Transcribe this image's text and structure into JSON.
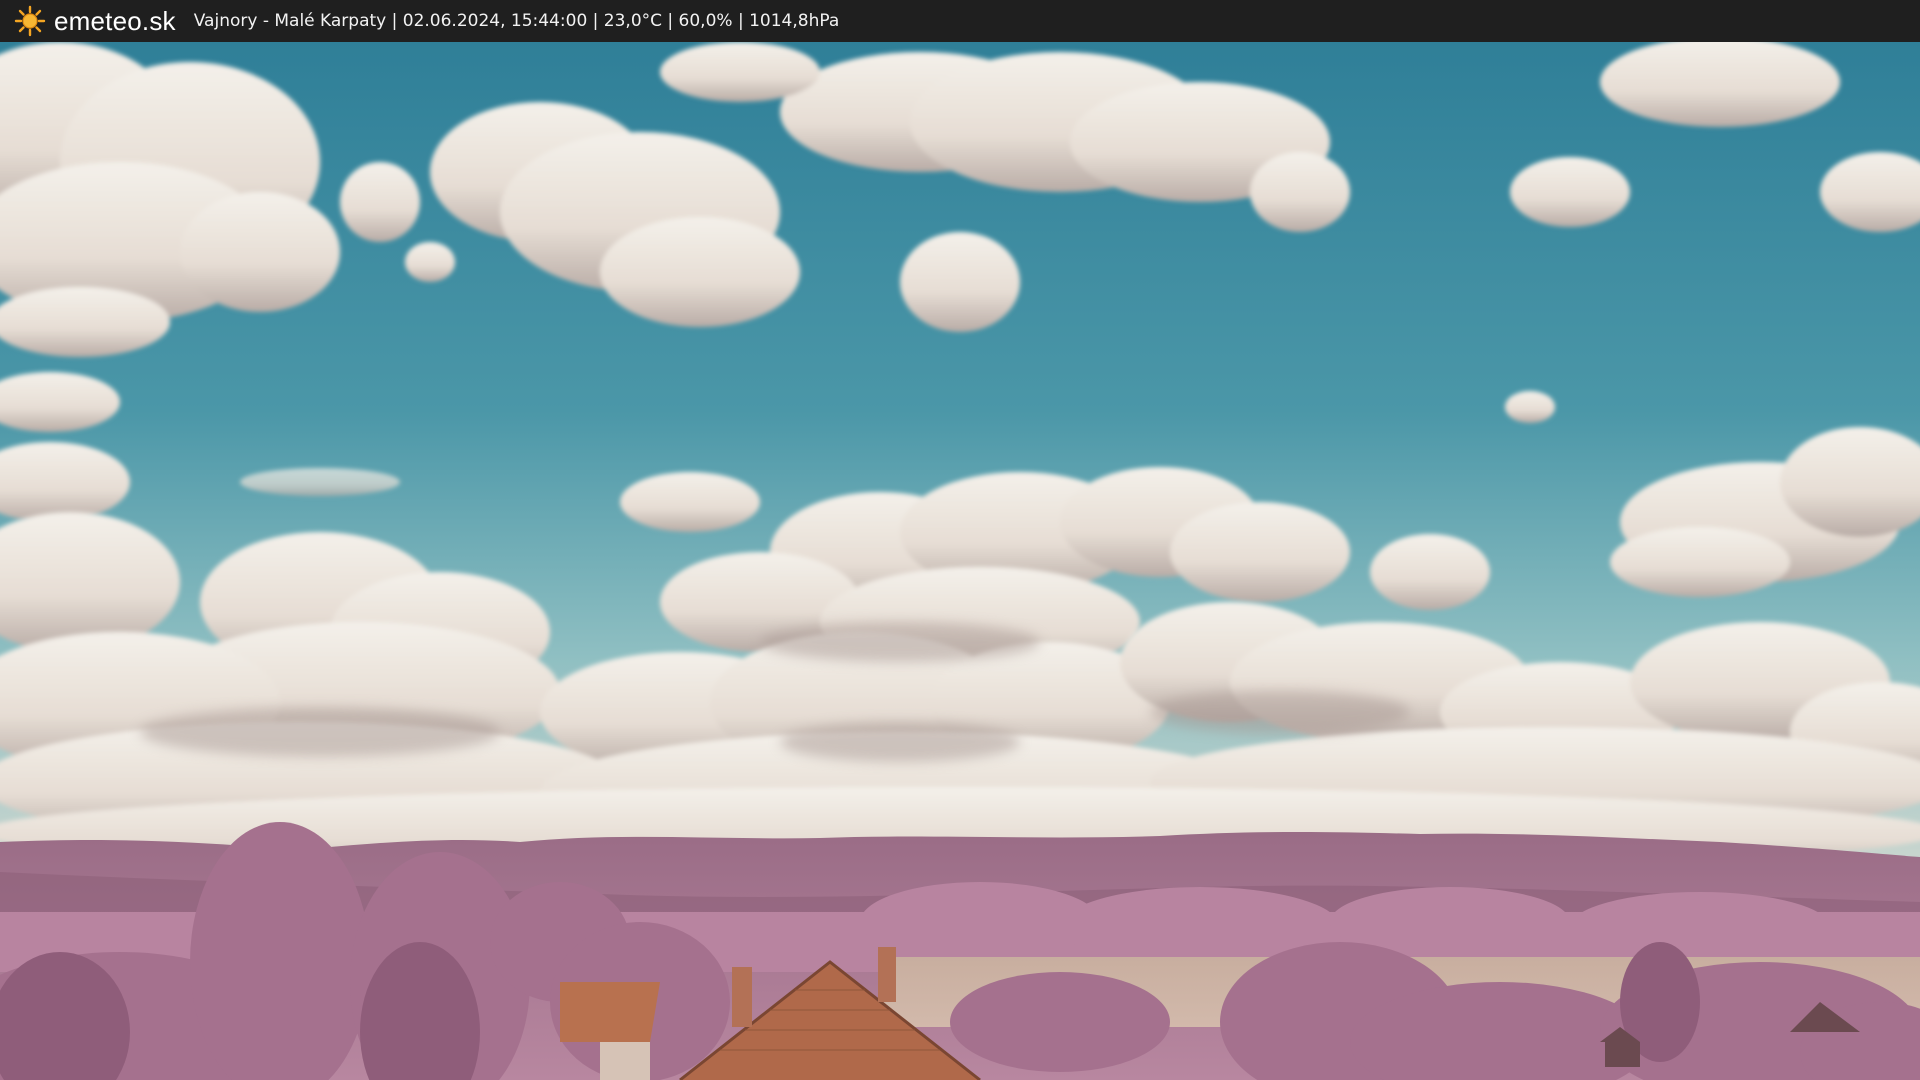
{
  "topbar": {
    "brand": "emeteo.sk",
    "caption": "Vajnory - Malé Karpaty | 02.06.2024, 15:44:00 | 23,0°C | 60,0% | 1014,8hPa",
    "logo_icon": "sun-icon",
    "background": "#1f1f1f",
    "text_color": "#ffffff",
    "sun_color": "#f5a623"
  },
  "scene": {
    "sky_top": "#2e7d96",
    "sky_bottom": "#9cc6c8",
    "cloud_color": "#efe9e2",
    "foliage_color": "#b4809a",
    "field_color": "#c9b2a6",
    "roof_color": "#b8724f"
  }
}
